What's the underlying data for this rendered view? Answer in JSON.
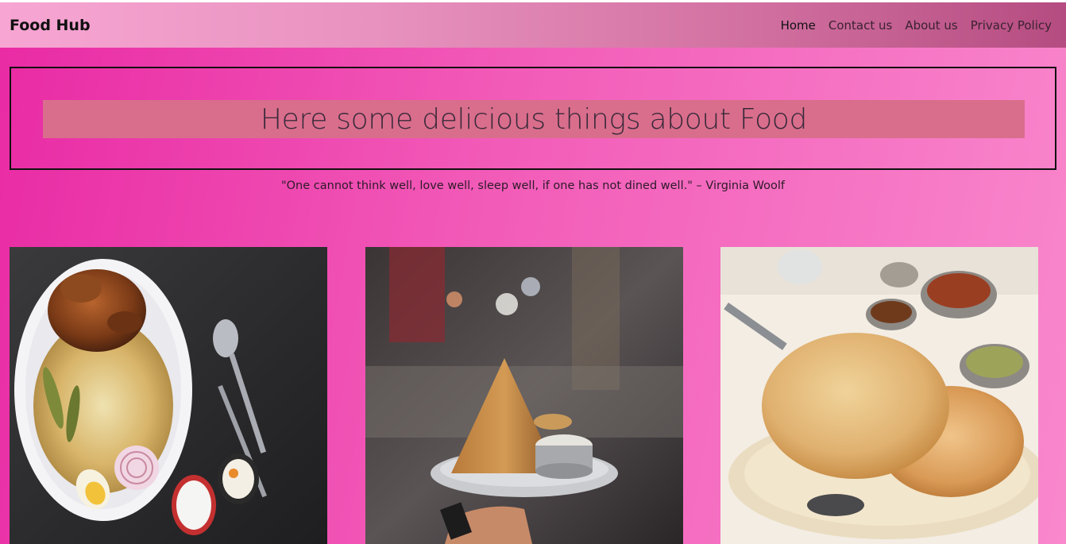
{
  "navbar": {
    "brand": "Food Hub",
    "links": [
      {
        "label": "Home",
        "active": true
      },
      {
        "label": "Contact us",
        "active": false
      },
      {
        "label": "About us",
        "active": false
      },
      {
        "label": "Privacy Policy",
        "active": false
      }
    ]
  },
  "hero": {
    "title": "Here some delicious things about Food"
  },
  "quote": "\"One cannot think well, love well, sleep well, if one has not dined well.\" – Virginia Woolf",
  "gallery": [
    {
      "image": "biryani-photo"
    },
    {
      "image": "dosa-photo"
    },
    {
      "image": "chole-bhature-photo"
    }
  ],
  "colors": {
    "background_start": "#e92aa4",
    "background_end": "#f988cd",
    "navbar_start": "#f7a6d3",
    "navbar_end": "#b54c81",
    "title_band": "#d96e8c"
  }
}
